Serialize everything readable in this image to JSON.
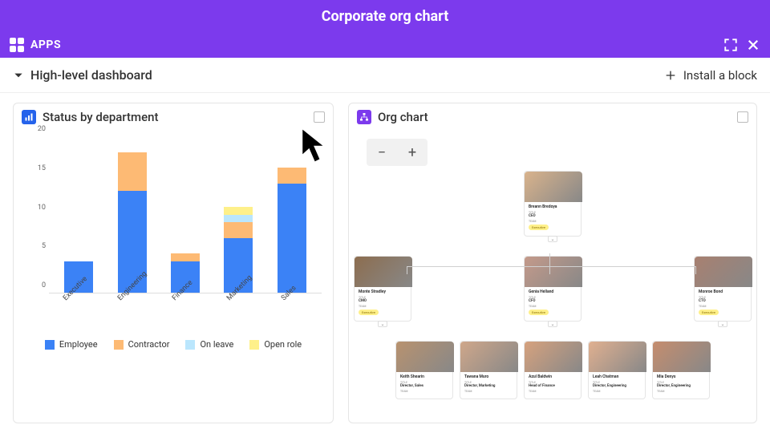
{
  "header": {
    "title": "Corporate org chart"
  },
  "toolbar": {
    "apps_label": "APPS"
  },
  "subheader": {
    "dashboard_label": "High-level dashboard",
    "install_label": "Install a block"
  },
  "chart_panel": {
    "title": "Status by department"
  },
  "org_panel": {
    "title": "Org chart"
  },
  "chart_data": {
    "type": "bar",
    "stacked": true,
    "categories": [
      "Executive",
      "Engineering",
      "Finance",
      "Marketing",
      "Sales"
    ],
    "series": [
      {
        "name": "Employee",
        "color": "#3b82f6",
        "values": [
          4,
          13,
          4,
          7,
          14
        ]
      },
      {
        "name": "Contractor",
        "color": "#fdba74",
        "values": [
          0,
          5,
          1,
          2,
          2
        ]
      },
      {
        "name": "On leave",
        "color": "#bae6fd",
        "values": [
          0,
          0,
          0,
          1,
          0
        ]
      },
      {
        "name": "Open role",
        "color": "#fef08a",
        "values": [
          0,
          0,
          0,
          1,
          0
        ]
      }
    ],
    "ylim": [
      0,
      20
    ],
    "y_ticks": [
      0,
      5,
      10,
      15,
      20
    ]
  },
  "org_chart": {
    "zoom": {
      "out": "−",
      "in": "+"
    },
    "levels": [
      [
        {
          "name": "Breann Bredoya",
          "title": "CEO",
          "team": "Executive",
          "expandable": true
        }
      ],
      [
        {
          "name": "Monte Stradley",
          "title": "CMO",
          "team": "Executive",
          "expandable": true
        },
        {
          "name": "Genia Helland",
          "title": "CFO",
          "team": "Executive",
          "expandable": true
        },
        {
          "name": "Monroe Bond",
          "title": "CTO",
          "team": "Executive",
          "expandable": true
        }
      ],
      [
        {
          "name": "Keith Shearin",
          "title": "Director, Sales",
          "team": ""
        },
        {
          "name": "Tawana Muro",
          "title": "Director, Marketing",
          "team": ""
        },
        {
          "name": "Azul Baldwin",
          "title": "Head of Finance",
          "team": ""
        },
        {
          "name": "Leah Chatman",
          "title": "Director, Engineering",
          "team": ""
        },
        {
          "name": "Mia Denys",
          "title": "Director, Engineering",
          "team": ""
        }
      ]
    ],
    "labels": {
      "title": "TITLE",
      "team": "TEAM",
      "badge": "Executive"
    }
  }
}
